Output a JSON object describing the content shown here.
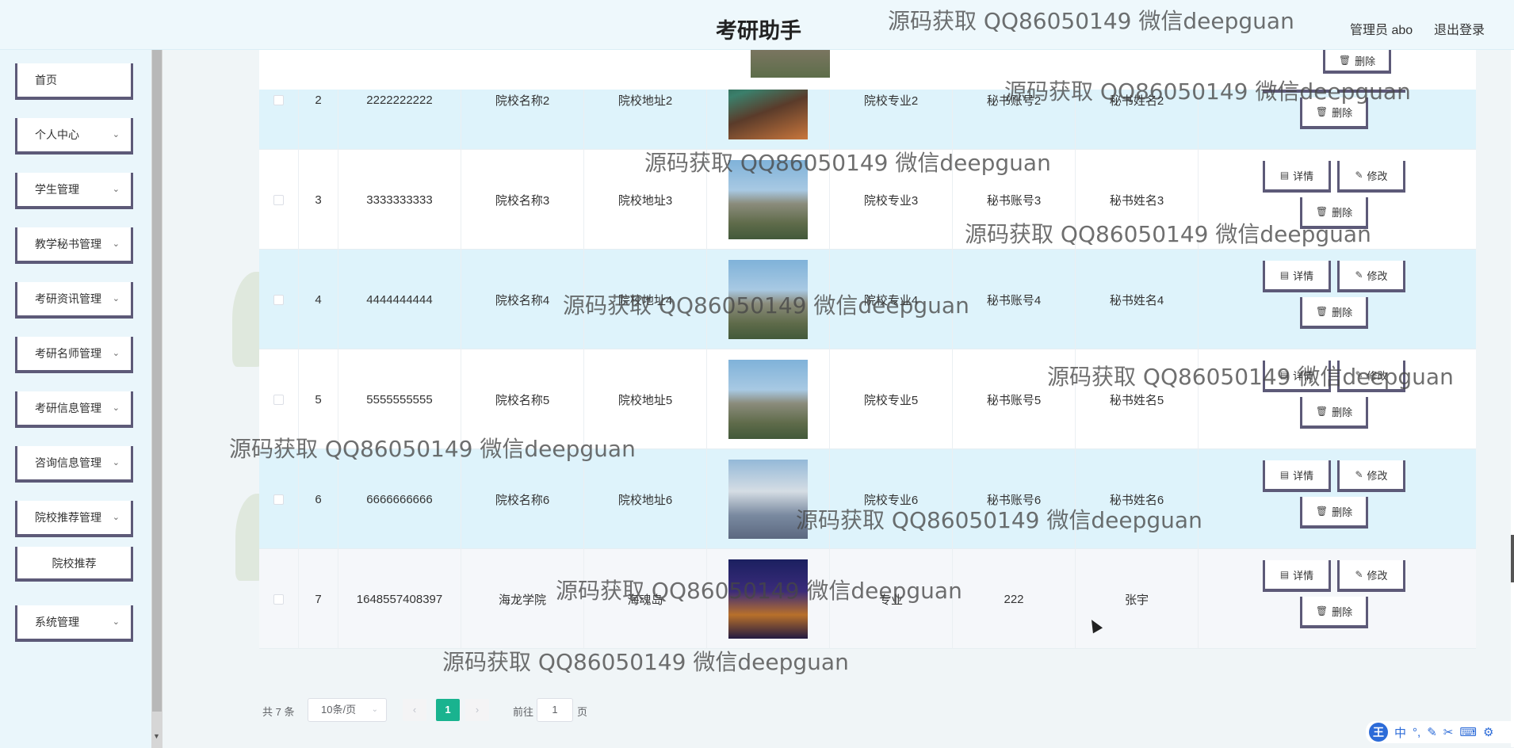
{
  "header": {
    "title": "考研助手",
    "user": "管理员 abo",
    "logout": "退出登录"
  },
  "sidebar": {
    "items": [
      {
        "label": "首页",
        "has_chevron": false
      },
      {
        "label": "个人中心",
        "has_chevron": true
      },
      {
        "label": "学生管理",
        "has_chevron": true
      },
      {
        "label": "教学秘书管理",
        "has_chevron": true
      },
      {
        "label": "考研资讯管理",
        "has_chevron": true
      },
      {
        "label": "考研名师管理",
        "has_chevron": true
      },
      {
        "label": "考研信息管理",
        "has_chevron": true
      },
      {
        "label": "咨询信息管理",
        "has_chevron": true
      },
      {
        "label": "院校推荐管理",
        "has_chevron": true
      },
      {
        "label": "院校推荐",
        "has_chevron": false,
        "sub": true
      },
      {
        "label": "系统管理",
        "has_chevron": true
      }
    ]
  },
  "table": {
    "rows": [
      {
        "index": "2",
        "code": "2222222222",
        "name": "院校名称2",
        "address": "院校地址2",
        "major": "院校专业2",
        "account": "秘书账号2",
        "secretary": "秘书姓名2",
        "image": "night-campus",
        "style": "blue"
      },
      {
        "index": "3",
        "code": "3333333333",
        "name": "院校名称3",
        "address": "院校地址3",
        "major": "院校专业3",
        "account": "秘书账号3",
        "secretary": "秘书姓名3",
        "image": "campus-building",
        "style": "white"
      },
      {
        "index": "4",
        "code": "4444444444",
        "name": "院校名称4",
        "address": "院校地址4",
        "major": "院校专业4",
        "account": "秘书账号4",
        "secretary": "秘书姓名4",
        "image": "campus-building",
        "style": "blue"
      },
      {
        "index": "5",
        "code": "5555555555",
        "name": "院校名称5",
        "address": "院校地址5",
        "major": "院校专业5",
        "account": "秘书账号5",
        "secretary": "秘书姓名5",
        "image": "campus-building",
        "style": "white"
      },
      {
        "index": "6",
        "code": "6666666666",
        "name": "院校名称6",
        "address": "院校地址6",
        "major": "院校专业6",
        "account": "秘书账号6",
        "secretary": "秘书姓名6",
        "image": "modern-building",
        "style": "blue"
      },
      {
        "index": "7",
        "code": "1648557408397",
        "name": "海龙学院",
        "address": "海魂岛",
        "major": "专业",
        "account": "222",
        "secretary": "张宇",
        "image": "night-tower",
        "style": "hover"
      }
    ],
    "actions": {
      "detail": "详情",
      "edit": "修改",
      "delete": "删除"
    }
  },
  "pagination": {
    "total": "共 7 条",
    "page_size": "10条/页",
    "current": "1",
    "goto_label": "前往",
    "goto_value": "1",
    "page_suffix": "页"
  },
  "watermark": "源码获取 QQ86050149 微信deepguan",
  "ime": {
    "label": "中"
  }
}
